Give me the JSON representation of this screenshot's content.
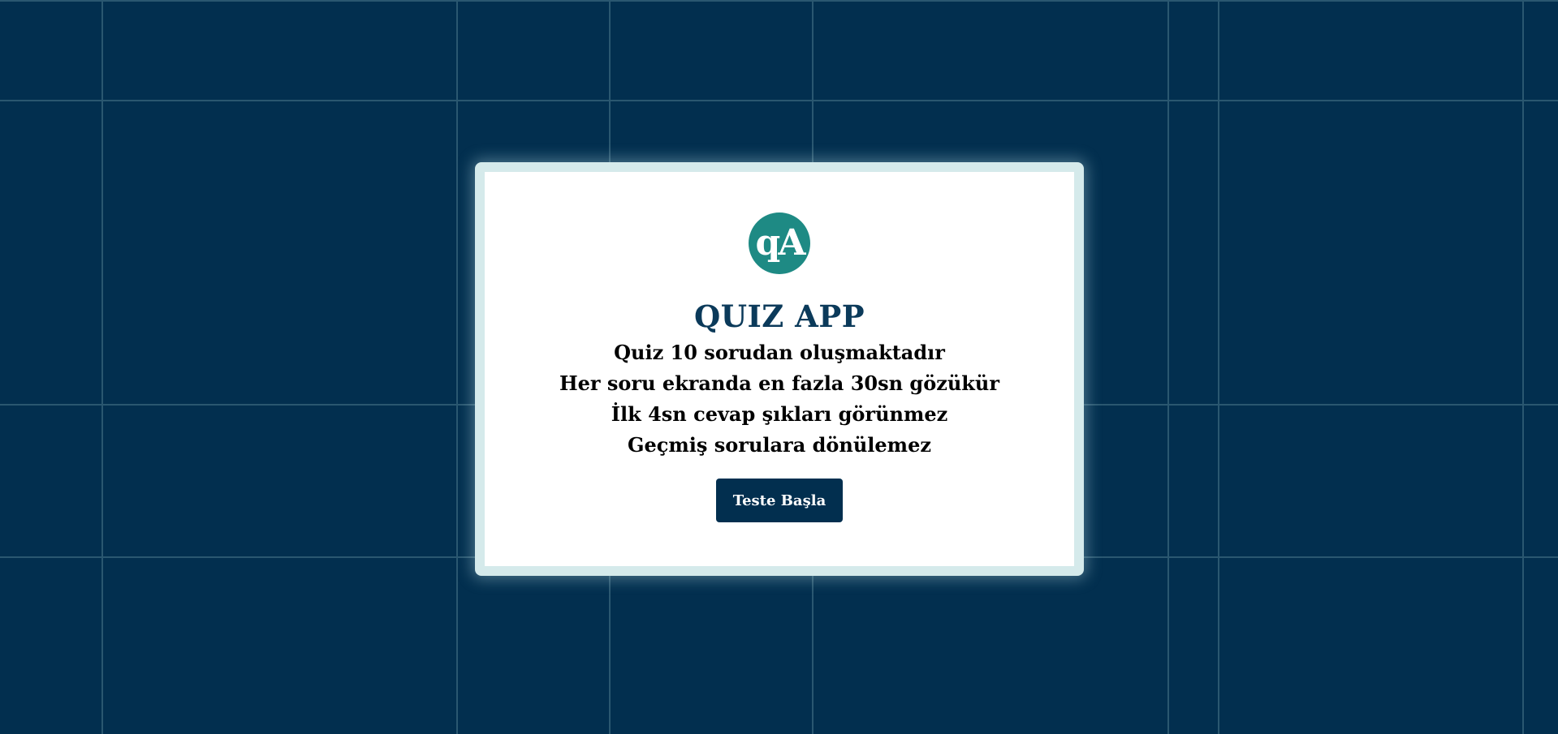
{
  "logo": {
    "text": "qA"
  },
  "title": "QUIZ APP",
  "rules": [
    "Quiz 10 sorudan oluşmaktadır",
    "Her soru ekranda en fazla 30sn gözükür",
    "İlk 4sn cevap şıkları görünmez",
    "Geçmiş sorulara dönülemez"
  ],
  "start_button": {
    "label": "Teste Başla"
  },
  "colors": {
    "background": "#022f4f",
    "grid_line": "#2a5770",
    "frame": "#d5eaeb",
    "logo": "#1e8a84",
    "title": "#0b3a5a",
    "button": "#022f4f"
  }
}
